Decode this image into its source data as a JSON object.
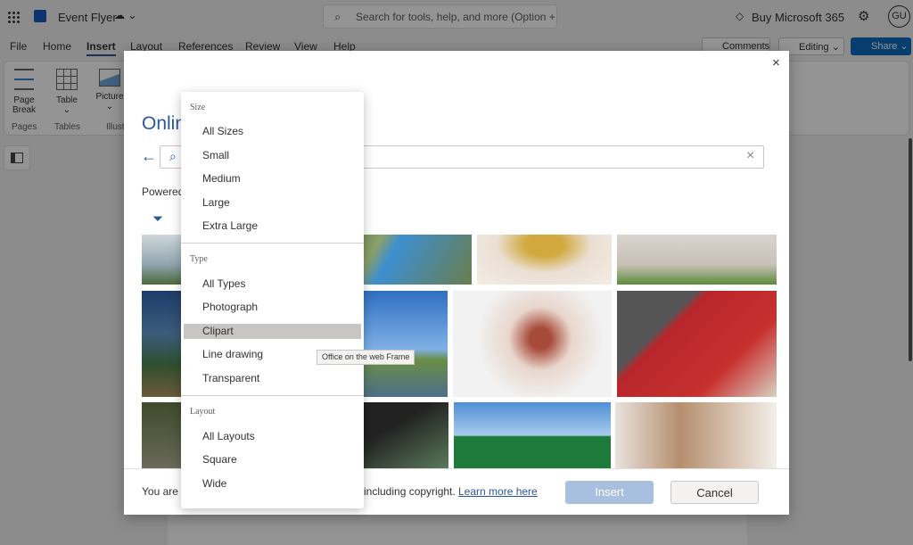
{
  "app": {
    "doc_title": "Event Flyer",
    "search_placeholder": "Search for tools, help, and more (Option + Q)",
    "buy": "Buy Microsoft 365",
    "avatar": "GU"
  },
  "tabs": [
    "File",
    "Home",
    "Insert",
    "Layout",
    "References",
    "Review",
    "View",
    "Help"
  ],
  "actions": {
    "comments": "Comments",
    "editing": "Editing",
    "share": "Share"
  },
  "ribbon": {
    "page_break": "Page Break",
    "pages": "Pages",
    "table": "Table",
    "tables": "Tables",
    "picture": "Picture",
    "illustrations": "Illustr"
  },
  "dialog": {
    "title": "Onlin",
    "powered": "Powered",
    "footer_left": "You are r",
    "footer_right": "including copyright.",
    "learn_more": "Learn more here",
    "insert": "Insert",
    "cancel": "Cancel"
  },
  "menu": {
    "size_header": "Size",
    "sizes": [
      "All Sizes",
      "Small",
      "Medium",
      "Large",
      "Extra Large"
    ],
    "type_header": "Type",
    "types": [
      "All Types",
      "Photograph",
      "Clipart",
      "Line drawing",
      "Transparent"
    ],
    "layout_header": "Layout",
    "layouts": [
      "All Layouts",
      "Square",
      "Wide"
    ],
    "selected": "Clipart"
  },
  "tooltip": "Office on the web Frame",
  "colors": {
    "accent": "#2b579a",
    "share": "#0f6cbd",
    "insert_disabled": "#a9bfdf"
  }
}
